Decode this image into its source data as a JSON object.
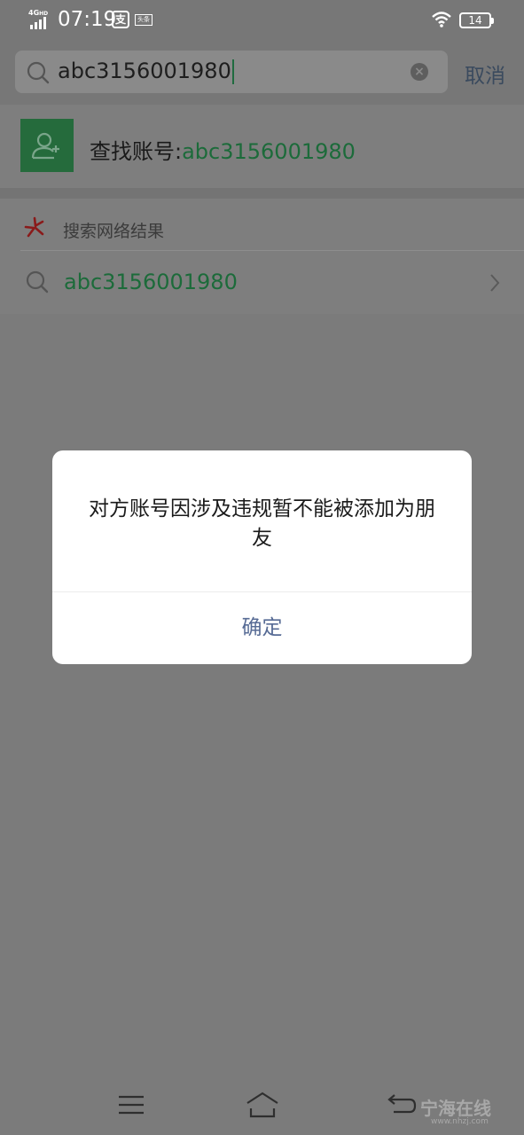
{
  "status_bar": {
    "network": "4G",
    "network_sub": "HD",
    "time": "07:19",
    "alipay_glyph": "支",
    "toutiao_glyph": "头条",
    "battery": "14"
  },
  "search": {
    "query": "abc3156001980",
    "clear_icon": "clear-icon",
    "cancel_label": "取消"
  },
  "find_account": {
    "prefix": "查找账号:",
    "account": "abc3156001980"
  },
  "network_results": {
    "title": "搜索网络结果",
    "item": "abc3156001980"
  },
  "dialog": {
    "message": "对方账号因涉及违规暂不能被添加为朋友",
    "confirm_label": "确定"
  },
  "watermark": {
    "text": "宁海在线",
    "url": "www.nhzj.com"
  },
  "colors": {
    "accent_green": "#1c6b3a",
    "dialog_button": "#576b95",
    "overlay": "#7b7b7b"
  }
}
